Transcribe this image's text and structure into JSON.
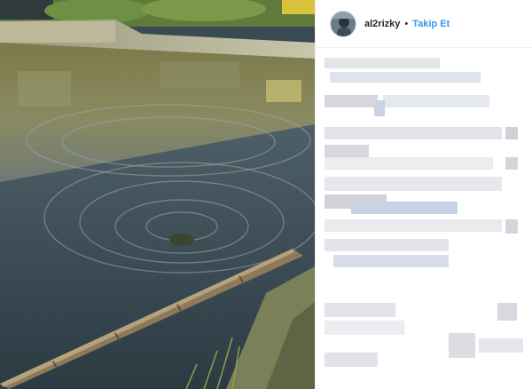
{
  "post": {
    "author": {
      "username": "al2rizky",
      "separator": "•",
      "follow_label": "Takip Et"
    },
    "media": {
      "kind": "video-still",
      "subject": "pond-water-ripples"
    },
    "comments_obscured": true
  },
  "colors": {
    "follow": "#3897f0",
    "text": "#262626",
    "border": "#efefef",
    "blur_light": "#e9e9ee",
    "blur_mid": "#d4d4dc",
    "blur_blue": "#c9d3e6"
  }
}
